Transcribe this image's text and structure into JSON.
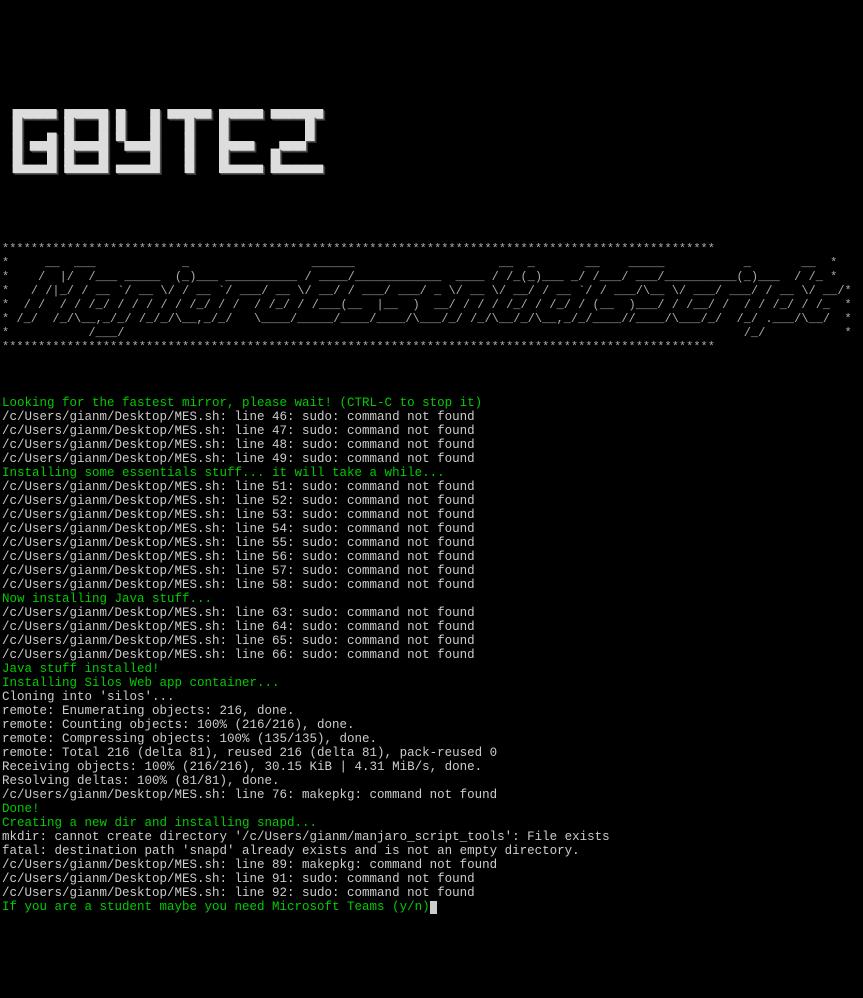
{
  "banner_logo": "GBYTEZ",
  "ascii_header": "***************************************************************************************************\n*     __  ___            _                 ______                    __  _       __    _____           _       __  *\n*    /  |/  /___ _____  (_)___ __________ / ____/____________  ____ / /_(_)___ _/ /___/ ___/__________(_)___  / /_ *\n*   / /|_/ / __ `/ __ \\/ / __ `/ ___/ __ \\/ __/ / ___/ ___/ _ \\/ __ \\/ __/ / __ `/ / ___/\\__ \\/ ___/ ___/ / __ \\/ __/*\n*  / /  / / /_/ / / / / / /_/ / /  / /_/ / /___(__  |__  )  __/ / / / /_/ / /_/ / (__  )___/ / /__/ /  / / /_/ / /_  *\n* /_/  /_/\\__,_/_/ /_/_/\\__,_/_/   \\____/_____/____/____/\\___/_/ /_/\\__/_/\\__,_/_/____//____/\\___/_/  /_/ .___/\\__/  *\n*           /___/                                                                                      /_/           *\n***************************************************************************************************",
  "lines": [
    {
      "type": "blank"
    },
    {
      "type": "info",
      "text": "Looking for the fastest mirror, please wait! (CTRL-C to stop it)"
    },
    {
      "type": "err",
      "text": "/c/Users/gianm/Desktop/MES.sh: line 46: sudo: command not found"
    },
    {
      "type": "err",
      "text": "/c/Users/gianm/Desktop/MES.sh: line 47: sudo: command not found"
    },
    {
      "type": "err",
      "text": "/c/Users/gianm/Desktop/MES.sh: line 48: sudo: command not found"
    },
    {
      "type": "err",
      "text": "/c/Users/gianm/Desktop/MES.sh: line 49: sudo: command not found"
    },
    {
      "type": "info",
      "text": "Installing some essentials stuff... it will take a while..."
    },
    {
      "type": "err",
      "text": "/c/Users/gianm/Desktop/MES.sh: line 51: sudo: command not found"
    },
    {
      "type": "err",
      "text": "/c/Users/gianm/Desktop/MES.sh: line 52: sudo: command not found"
    },
    {
      "type": "err",
      "text": "/c/Users/gianm/Desktop/MES.sh: line 53: sudo: command not found"
    },
    {
      "type": "err",
      "text": "/c/Users/gianm/Desktop/MES.sh: line 54: sudo: command not found"
    },
    {
      "type": "err",
      "text": "/c/Users/gianm/Desktop/MES.sh: line 55: sudo: command not found"
    },
    {
      "type": "err",
      "text": "/c/Users/gianm/Desktop/MES.sh: line 56: sudo: command not found"
    },
    {
      "type": "err",
      "text": "/c/Users/gianm/Desktop/MES.sh: line 57: sudo: command not found"
    },
    {
      "type": "err",
      "text": "/c/Users/gianm/Desktop/MES.sh: line 58: sudo: command not found"
    },
    {
      "type": "info",
      "text": "Now installing Java stuff..."
    },
    {
      "type": "err",
      "text": "/c/Users/gianm/Desktop/MES.sh: line 63: sudo: command not found"
    },
    {
      "type": "err",
      "text": "/c/Users/gianm/Desktop/MES.sh: line 64: sudo: command not found"
    },
    {
      "type": "err",
      "text": "/c/Users/gianm/Desktop/MES.sh: line 65: sudo: command not found"
    },
    {
      "type": "err",
      "text": "/c/Users/gianm/Desktop/MES.sh: line 66: sudo: command not found"
    },
    {
      "type": "info",
      "text": "Java stuff installed!"
    },
    {
      "type": "info",
      "text": "Installing Silos Web app container..."
    },
    {
      "type": "err",
      "text": "Cloning into 'silos'..."
    },
    {
      "type": "err",
      "text": "remote: Enumerating objects: 216, done."
    },
    {
      "type": "err",
      "text": "remote: Counting objects: 100% (216/216), done."
    },
    {
      "type": "err",
      "text": "remote: Compressing objects: 100% (135/135), done."
    },
    {
      "type": "err",
      "text": "remote: Total 216 (delta 81), reused 216 (delta 81), pack-reused 0"
    },
    {
      "type": "err",
      "text": "Receiving objects: 100% (216/216), 30.15 KiB | 4.31 MiB/s, done."
    },
    {
      "type": "err",
      "text": "Resolving deltas: 100% (81/81), done."
    },
    {
      "type": "err",
      "text": "/c/Users/gianm/Desktop/MES.sh: line 76: makepkg: command not found"
    },
    {
      "type": "info",
      "text": "Done!"
    },
    {
      "type": "info",
      "text": "Creating a new dir and installing snapd..."
    },
    {
      "type": "err",
      "text": "mkdir: cannot create directory '/c/Users/gianm/manjaro_script_tools': File exists"
    },
    {
      "type": "err",
      "text": "fatal: destination path 'snapd' already exists and is not an empty directory."
    },
    {
      "type": "err",
      "text": "/c/Users/gianm/Desktop/MES.sh: line 89: makepkg: command not found"
    },
    {
      "type": "err",
      "text": "/c/Users/gianm/Desktop/MES.sh: line 91: sudo: command not found"
    },
    {
      "type": "err",
      "text": "/c/Users/gianm/Desktop/MES.sh: line 92: sudo: command not found"
    },
    {
      "type": "prompt",
      "text": "If you are a student maybe you need Microsoft Teams (y/n)"
    }
  ]
}
